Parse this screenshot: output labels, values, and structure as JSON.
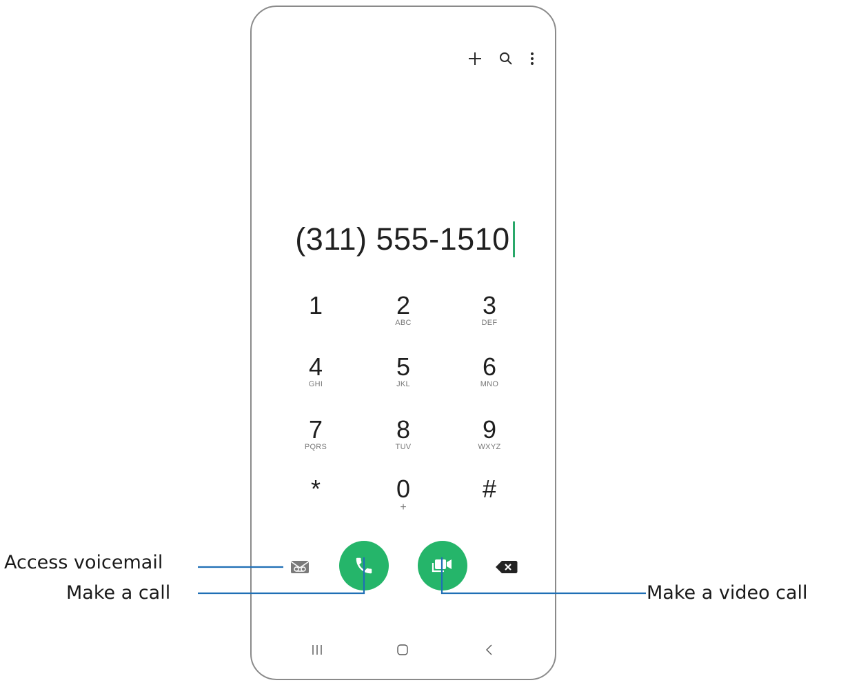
{
  "dialer": {
    "number": "(311) 555-1510",
    "keys": [
      {
        "digit": "1",
        "letters": ""
      },
      {
        "digit": "2",
        "letters": "ABC"
      },
      {
        "digit": "3",
        "letters": "DEF"
      },
      {
        "digit": "4",
        "letters": "GHI"
      },
      {
        "digit": "5",
        "letters": "JKL"
      },
      {
        "digit": "6",
        "letters": "MNO"
      },
      {
        "digit": "7",
        "letters": "PQRS"
      },
      {
        "digit": "8",
        "letters": "TUV"
      },
      {
        "digit": "9",
        "letters": "WXYZ"
      },
      {
        "digit": "*",
        "letters": ""
      },
      {
        "digit": "0",
        "letters": "+"
      },
      {
        "digit": "#",
        "letters": ""
      }
    ]
  },
  "top_icons": [
    "plus-icon",
    "search-icon",
    "more-vert-icon"
  ],
  "nav_icons": [
    "recents-icon",
    "home-icon",
    "back-icon"
  ],
  "callouts": {
    "voicemail": "Access voicemail",
    "call": "Make a call",
    "video": "Make a video call"
  },
  "colors": {
    "accent_green": "#25b56a",
    "callout_line": "#1f6fb5"
  }
}
